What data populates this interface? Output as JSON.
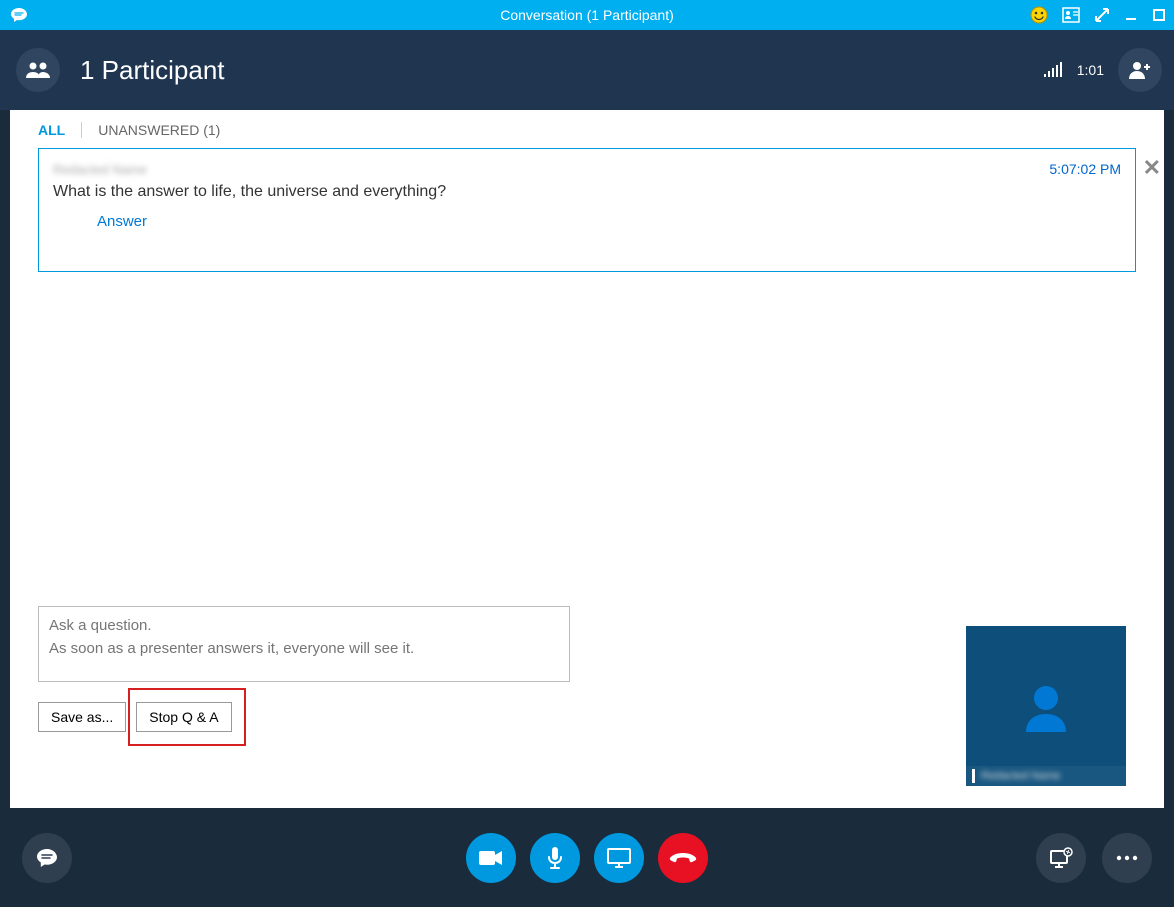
{
  "titleBar": {
    "title": "Conversation (1 Participant)"
  },
  "header": {
    "participantLabel": "1 Participant",
    "timer": "1:01"
  },
  "tabs": {
    "all": "ALL",
    "unanswered": "UNANSWERED (1)"
  },
  "question": {
    "name": "Redacted Name",
    "time": "5:07:02 PM",
    "text": "What is the answer to life, the universe and everything?",
    "answerLabel": "Answer",
    "dismiss": "✕"
  },
  "askBox": {
    "placeholder": "Ask a question.\nAs soon as a presenter answers it, everyone will see it."
  },
  "buttons": {
    "saveAs": "Save as...",
    "stopQA": "Stop Q & A"
  },
  "videoThumb": {
    "name": "Redacted Name"
  }
}
